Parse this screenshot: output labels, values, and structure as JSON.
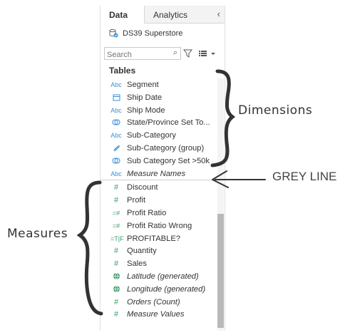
{
  "tabs": {
    "data": "Data",
    "analytics": "Analytics"
  },
  "datasource": {
    "name": "DS39 Superstore"
  },
  "search": {
    "placeholder": "Search"
  },
  "tables_header": "Tables",
  "dimensions": [
    {
      "icon": "Abc",
      "label": "Segment",
      "italic": false
    },
    {
      "icon": "calendar",
      "label": "Ship Date",
      "italic": false
    },
    {
      "icon": "Abc",
      "label": "Ship Mode",
      "italic": false
    },
    {
      "icon": "set",
      "label": "State/Province Set To...",
      "italic": false
    },
    {
      "icon": "Abc",
      "label": "Sub-Category",
      "italic": false
    },
    {
      "icon": "paperclip",
      "label": "Sub-Category (group)",
      "italic": false
    },
    {
      "icon": "set",
      "label": "Sub Category Set >50k",
      "italic": false
    },
    {
      "icon": "Abc",
      "label": "Measure Names",
      "italic": true
    }
  ],
  "measures": [
    {
      "icon": "#",
      "label": "Discount",
      "italic": false
    },
    {
      "icon": "#",
      "label": "Profit",
      "italic": false
    },
    {
      "icon": "=#",
      "label": "Profit Ratio",
      "italic": false
    },
    {
      "icon": "=#",
      "label": "Profit Ratio Wrong",
      "italic": false
    },
    {
      "icon": "=T|F",
      "label": "PROFITABLE?",
      "italic": false
    },
    {
      "icon": "#",
      "label": "Quantity",
      "italic": false
    },
    {
      "icon": "#",
      "label": "Sales",
      "italic": false
    },
    {
      "icon": "globe",
      "label": "Latitude (generated)",
      "italic": true
    },
    {
      "icon": "globe",
      "label": "Longitude (generated)",
      "italic": true
    },
    {
      "icon": "#",
      "label": "Orders (Count)",
      "italic": true
    },
    {
      "icon": "#",
      "label": "Measure Values",
      "italic": true
    }
  ],
  "annotations": {
    "dimensions": "Dimensions",
    "grey_line": "GREY LINE",
    "measures": "Measures"
  }
}
